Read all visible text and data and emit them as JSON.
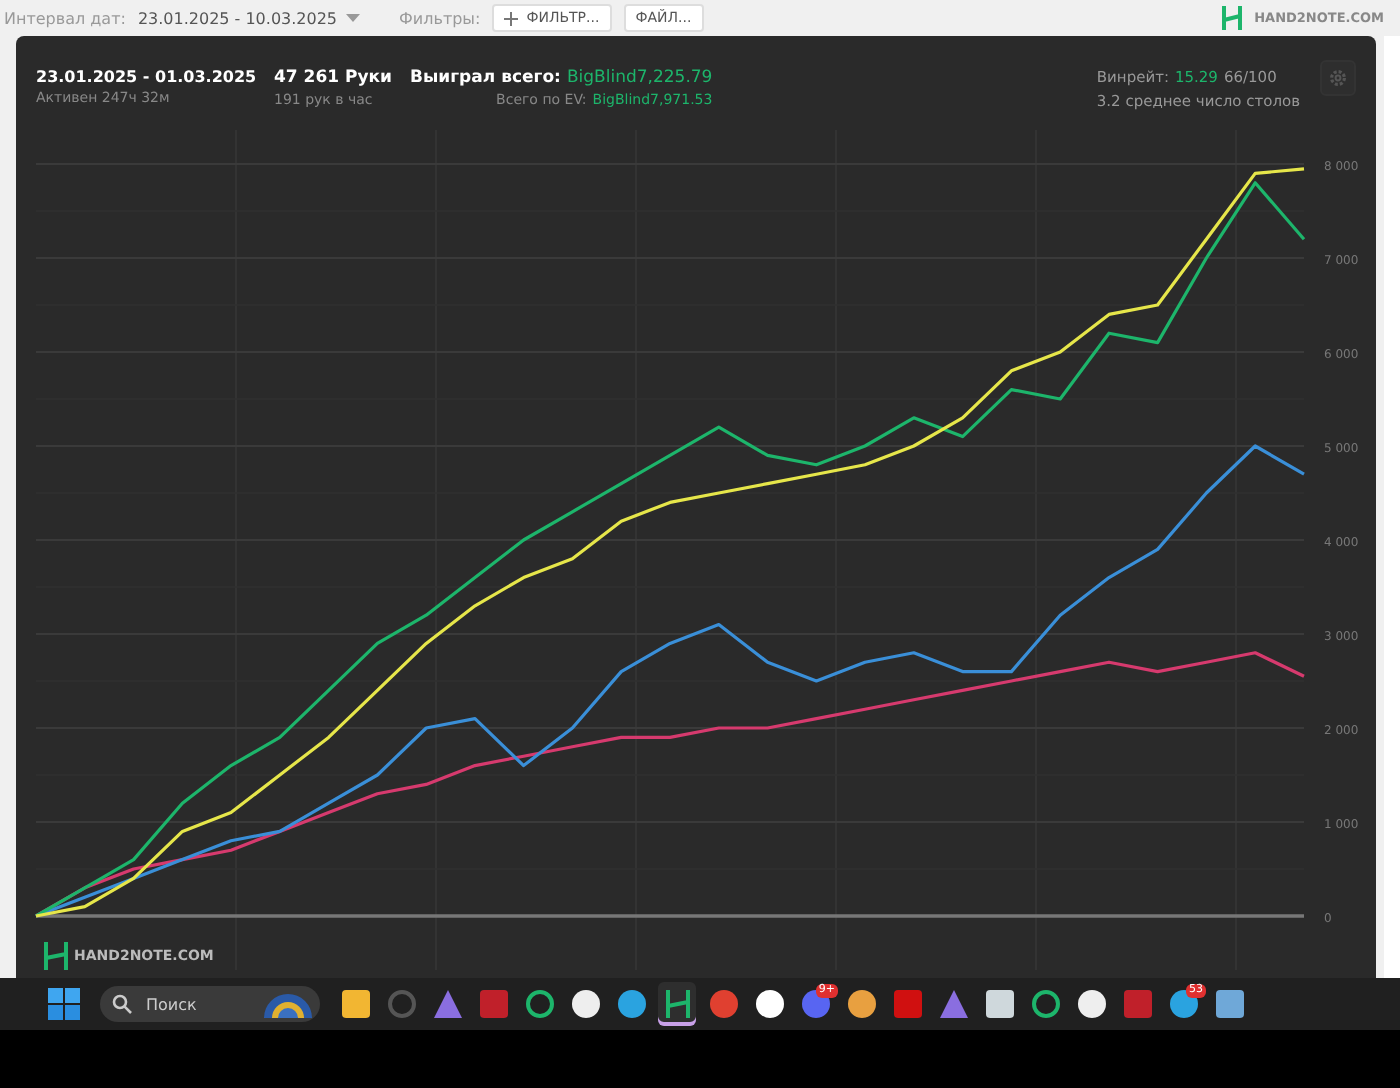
{
  "toolbar": {
    "date_label": "Интервал дат:",
    "date_range": "23.01.2025 - 10.03.2025",
    "filters_label": "Фильтры:",
    "buttons": [
      "ФИЛЬТР...",
      "ФАЙЛ..."
    ],
    "logo": "HAND2NOTE.COM"
  },
  "summary": {
    "period": "23.01.2025 - 01.03.2025",
    "active": "Активен 247ч 32м",
    "hands": "47 261 Руки",
    "hands_rate": "191 рук в час",
    "won_label": "Выиграл всего:",
    "won_value": "BigBlind7,225.79",
    "ev_label": "Всего по EV:",
    "ev_value": "BigBlind7,971.53",
    "winrate_label": "Винрейт:",
    "winrate_value": "15.29",
    "winrate_unit": "66/100",
    "tables": "3.2 среднее число столов"
  },
  "chart_data": {
    "type": "line",
    "grid": true,
    "ylim": [
      0,
      8000
    ],
    "yticks": [
      {
        "value": 0,
        "label": "0"
      },
      {
        "value": 1000,
        "label": "1 000"
      },
      {
        "value": 2000,
        "label": "2 000"
      },
      {
        "value": 3000,
        "label": "3 000"
      },
      {
        "value": 4000,
        "label": "4 000"
      },
      {
        "value": 5000,
        "label": "5 000"
      },
      {
        "value": 6000,
        "label": "6 000"
      },
      {
        "value": 7000,
        "label": "7 000"
      },
      {
        "value": 8000,
        "label": "8 000"
      }
    ],
    "series": [
      {
        "color": "#d63a6e",
        "values": [
          0,
          300,
          500,
          600,
          700,
          900,
          1100,
          1300,
          1400,
          1600,
          1700,
          1800,
          1900,
          1900,
          2000,
          2000,
          2100,
          2200,
          2300,
          2400,
          2500,
          2600,
          2700,
          2600,
          2700,
          2800,
          2550
        ]
      },
      {
        "color": "#3a8fd8",
        "values": [
          0,
          200,
          400,
          600,
          800,
          900,
          1200,
          1500,
          2000,
          2100,
          1600,
          2000,
          2600,
          2900,
          3100,
          2700,
          2500,
          2700,
          2800,
          2600,
          2600,
          3200,
          3600,
          3900,
          4500,
          5000,
          4700
        ]
      },
      {
        "color": "#1db56b",
        "values": [
          0,
          300,
          600,
          1200,
          1600,
          1900,
          2400,
          2900,
          3200,
          3600,
          4000,
          4300,
          4600,
          4900,
          5200,
          4900,
          4800,
          5000,
          5300,
          5100,
          5600,
          5500,
          6200,
          6100,
          7000,
          7800,
          7200
        ]
      },
      {
        "color": "#e6e64a",
        "values": [
          0,
          100,
          400,
          900,
          1100,
          1500,
          1900,
          2400,
          2900,
          3300,
          3600,
          3800,
          4200,
          4400,
          4500,
          4600,
          4700,
          4800,
          5000,
          5300,
          5800,
          6000,
          6400,
          6500,
          7200,
          7900,
          7950
        ]
      }
    ]
  },
  "chart_logo": "HAND2NOTE.COM",
  "taskbar": {
    "search": {
      "placeholder": "Поиск"
    },
    "badges": [
      "9+",
      "53"
    ]
  }
}
